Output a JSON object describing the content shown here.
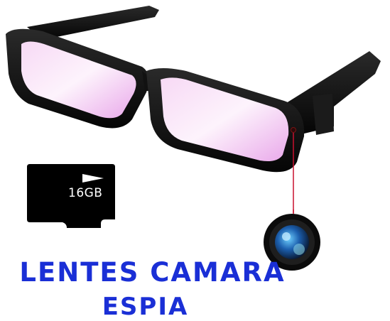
{
  "sd_card": {
    "capacity_label": "16GB"
  },
  "caption": {
    "line1": "LENTES CAMARA",
    "line2": "ESPIA"
  },
  "colors": {
    "caption_text": "#1a2fd6",
    "frame": "#111111",
    "lens_tint": "#f3c6f0",
    "pointer_line": "#c8102e"
  }
}
